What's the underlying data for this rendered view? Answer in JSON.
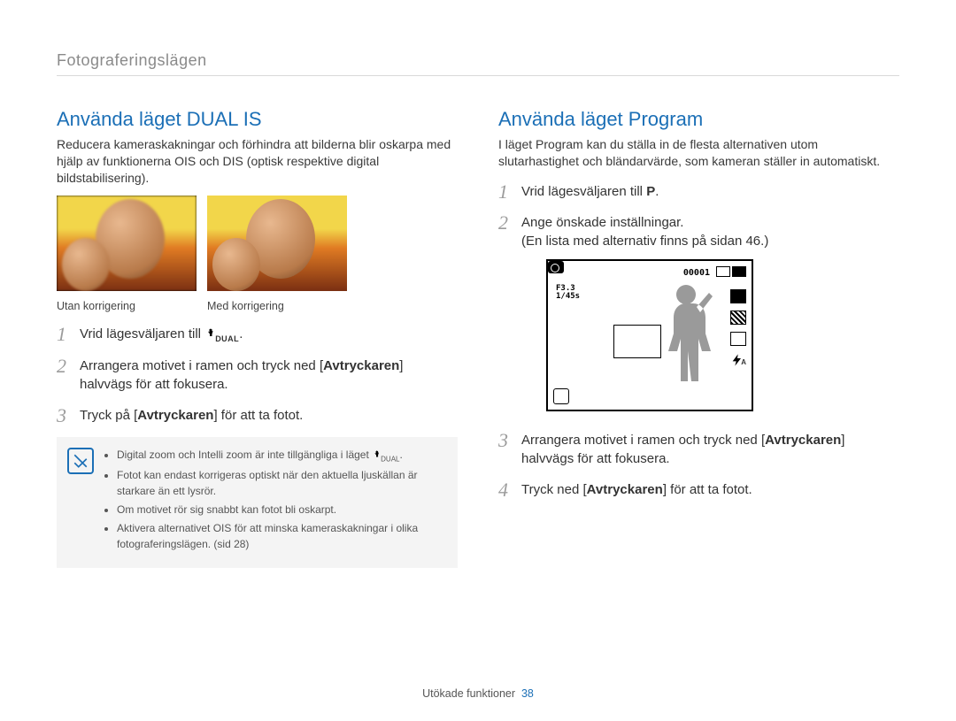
{
  "breadcrumb": "Fotograferingslägen",
  "left": {
    "title": "Använda läget DUAL IS",
    "intro": "Reducera kameraskakningar och förhindra att bilderna blir oskarpa med hjälp av funktionerna OIS och DIS (optisk respektive digital bildstabilisering).",
    "caption_before": "Utan korrigering",
    "caption_after": "Med korrigering",
    "step1_pre": "Vrid lägesväljaren till ",
    "step1_icon": "DUAL",
    "step1_post": ".",
    "step2_pre": "Arrangera motivet i ramen och tryck ned [",
    "step2_bold": "Avtryckaren",
    "step2_post": "] halvvägs för att fokusera.",
    "step3_pre": "Tryck på [",
    "step3_bold": "Avtryckaren",
    "step3_post": "] för att ta fotot.",
    "note1_pre": "Digital zoom och Intelli zoom är inte tillgängliga i läget ",
    "note1_icon": "DUAL",
    "note1_post": ".",
    "note2": "Fotot kan endast korrigeras optiskt när den aktuella ljuskällan är starkare än ett lysrör.",
    "note3": "Om motivet rör sig snabbt kan fotot bli oskarpt.",
    "note4": "Aktivera alternativet OIS för att minska kameraskakningar i olika fotograferingslägen. (sid 28)"
  },
  "right": {
    "title": "Använda läget Program",
    "intro": "I läget Program kan du ställa in de flesta alternativen utom slutarhastighet och bländarvärde, som kameran ställer in automatiskt.",
    "step1_pre": "Vrid lägesväljaren till ",
    "step1_icon": "P",
    "step1_post": ".",
    "step2_a": "Ange önskade inställningar.",
    "step2_b": "(En lista med alternativ finns på sidan 46.)",
    "lcd": {
      "counter": "00001",
      "f": "F3.3",
      "shutter": "1/45s",
      "flash": "A"
    },
    "step3_pre": "Arrangera motivet i ramen och tryck ned [",
    "step3_bold": "Avtryckaren",
    "step3_post": "] halvvägs för att fokusera.",
    "step4_pre": "Tryck ned [",
    "step4_bold": "Avtryckaren",
    "step4_post": "] för att ta fotot."
  },
  "footer_label": "Utökade funktioner",
  "footer_page": "38"
}
